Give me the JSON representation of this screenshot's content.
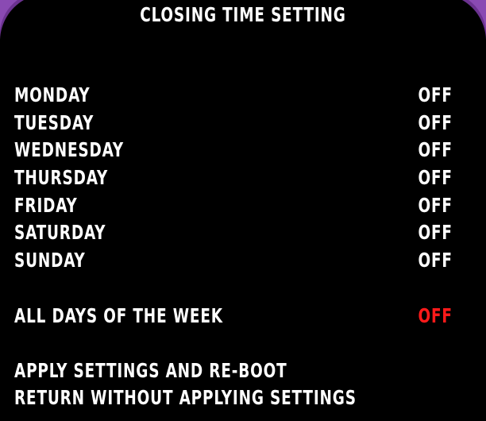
{
  "screen": {
    "title": "CLOSING TIME SETTING"
  },
  "days": [
    {
      "label": "MONDAY",
      "value": "OFF"
    },
    {
      "label": "TUESDAY",
      "value": "OFF"
    },
    {
      "label": "WEDNESDAY",
      "value": "OFF"
    },
    {
      "label": "THURSDAY",
      "value": "OFF"
    },
    {
      "label": "FRIDAY",
      "value": "OFF"
    },
    {
      "label": "SATURDAY",
      "value": "OFF"
    },
    {
      "label": "SUNDAY",
      "value": "OFF"
    }
  ],
  "all_days": {
    "label": "ALL DAYS OF THE WEEK",
    "value": "OFF"
  },
  "actions": {
    "apply": "APPLY SETTINGS AND RE-BOOT",
    "return": "RETURN WITHOUT APPLYING SETTINGS"
  },
  "colors": {
    "background": "#000000",
    "text": "#ffffff",
    "highlight": "#ff1a1a",
    "corner_frame": "#7a3fa0"
  }
}
